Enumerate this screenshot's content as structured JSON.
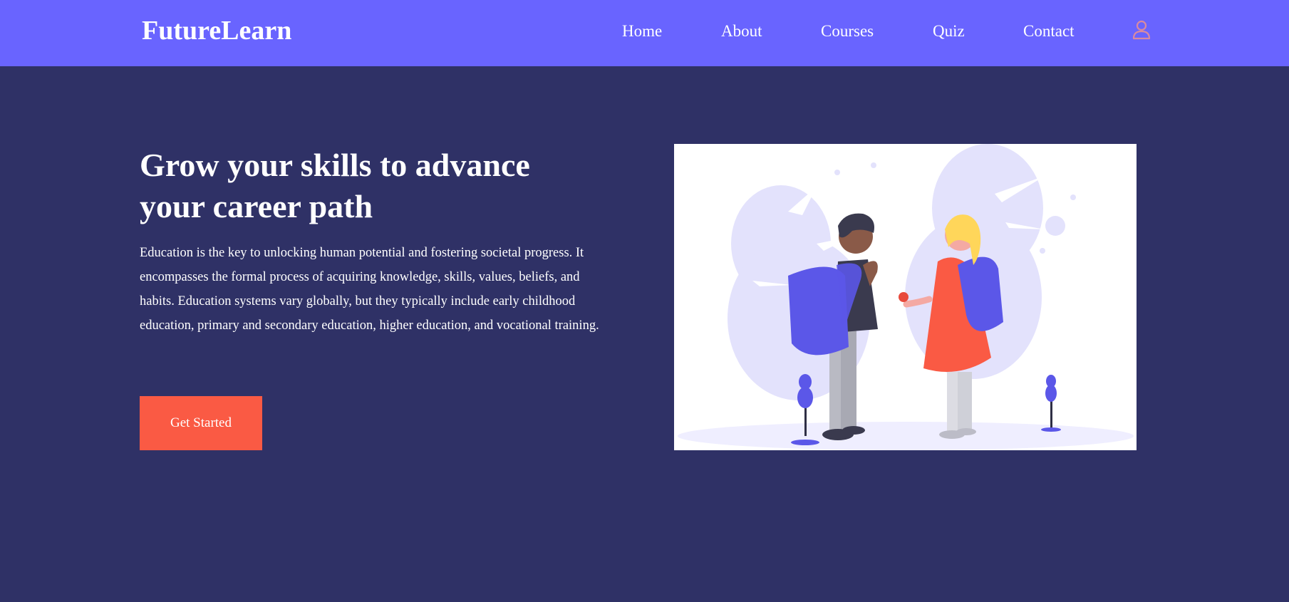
{
  "header": {
    "logo": "FutureLearn",
    "nav": [
      {
        "label": "Home"
      },
      {
        "label": "About"
      },
      {
        "label": "Courses"
      },
      {
        "label": "Quiz"
      },
      {
        "label": "Contact"
      }
    ],
    "account_icon": "user-icon"
  },
  "hero": {
    "title": "Grow your skills to advance your career path",
    "description": "Education is the key to unlocking human potential and fostering societal progress. It encompasses the formal process of acquiring knowledge, skills, values, beliefs, and habits. Education systems vary globally, but they typically include early childhood education, primary and secondary education, higher education, and vocational training.",
    "cta_label": "Get Started",
    "illustration": "students-with-backpacks-illustration"
  },
  "colors": {
    "navbar_bg": "#6964ff",
    "page_bg": "#2f3166",
    "cta_bg": "#fa5a44",
    "icon_accent": "#d98aa0"
  }
}
